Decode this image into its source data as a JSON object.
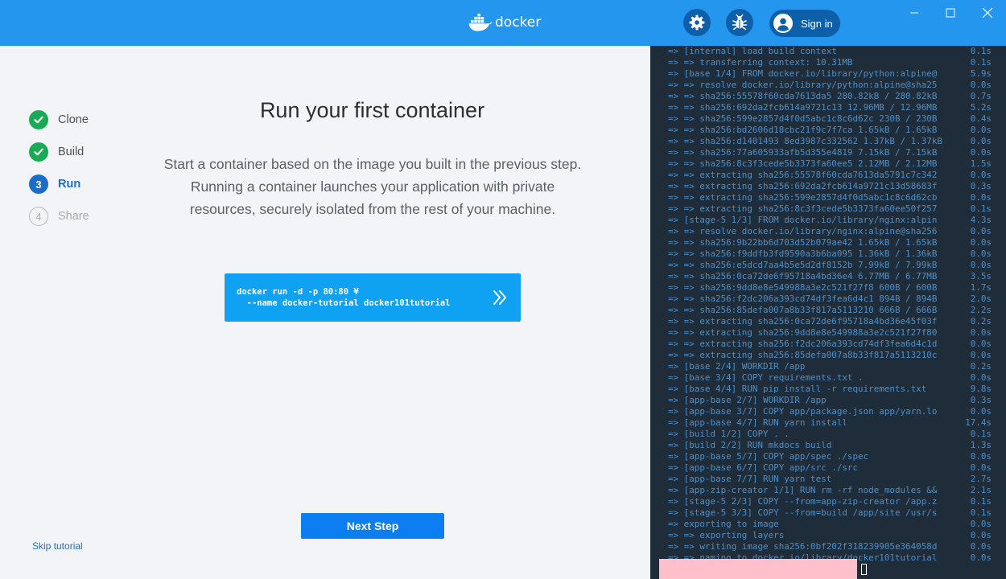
{
  "titlebar": {
    "brand": "docker",
    "signin_label": "Sign in",
    "icons": [
      "settings-icon",
      "bug-icon",
      "user-icon",
      "minimize-icon",
      "maximize-icon",
      "close-icon"
    ]
  },
  "steps": [
    {
      "number": "1",
      "label": "Clone",
      "state": "done"
    },
    {
      "number": "2",
      "label": "Build",
      "state": "done"
    },
    {
      "number": "3",
      "label": "Run",
      "state": "active"
    },
    {
      "number": "4",
      "label": "Share",
      "state": "todo"
    }
  ],
  "skip_label": "Skip tutorial",
  "main": {
    "title": "Run your first container",
    "description": "Start a container based on the image you built in the previous step. Running a container launches your application with private resources, securely isolated from the rest of your machine.",
    "command": "docker run -d -p 80:80 ¥\n  --name docker-tutorial docker101tutorial",
    "next_label": "Next Step"
  },
  "colors": {
    "accent": "#2496ed",
    "done": "#1aaa55",
    "active": "#1d6cc9",
    "command_bg": "#0fa2f2",
    "terminal_bg": "#1f2c39",
    "terminal_text": "#4f8fc7"
  },
  "terminal": {
    "lines": [
      {
        "t": "=> [internal] load build context",
        "tm": "0.1s"
      },
      {
        "t": "=> => transferring context: 10.31MB",
        "tm": "0.1s"
      },
      {
        "t": "=> [base 1/4] FROM docker.io/library/python:alpine@",
        "tm": "5.9s"
      },
      {
        "t": "=> => resolve docker.io/library/python:alpine@sha25",
        "tm": "0.0s"
      },
      {
        "t": "=> => sha256:55578f60cda7613da5 280.82kB / 280.82kB",
        "tm": "0.7s"
      },
      {
        "t": "=> => sha256:692da2fcb614a9721c13 12.96MB / 12.96MB",
        "tm": "5.2s"
      },
      {
        "t": "=> => sha256:599e2857d4f0d5abc1c8c6d62c 230B / 230B",
        "tm": "0.4s"
      },
      {
        "t": "=> => sha256:bd2606d18cbc21f9c7f7ca 1.65kB / 1.65kB",
        "tm": "0.0s"
      },
      {
        "t": "=> => sha256:d1401493 8ed3987c332562 1.37kB / 1.37kB",
        "tm": "0.0s"
      },
      {
        "t": "=> => sha256:77a605933afb5d355e4819 7.15kB / 7.15kB",
        "tm": "0.0s"
      },
      {
        "t": "=> => sha256:8c3f3cede5b3373fa60ee5 2.12MB / 2.12MB",
        "tm": "1.5s"
      },
      {
        "t": "=> => extracting sha256:55578f60cda7613da5791c7c342",
        "tm": "0.0s"
      },
      {
        "t": "=> => extracting sha256:692da2fcb614a9721c13d58683f",
        "tm": "0.3s"
      },
      {
        "t": "=> => extracting sha256:599e2857d4f0d5abc1c8c6d62cb",
        "tm": "0.0s"
      },
      {
        "t": "=> => extracting sha256:8c3f3cede5b3373fa60ee50f257",
        "tm": "0.1s"
      },
      {
        "t": "=> [stage-5 1/3] FROM docker.io/library/nginx:alpin",
        "tm": "4.3s"
      },
      {
        "t": "=> => resolve docker.io/library/nginx:alpine@sha256",
        "tm": "0.0s"
      },
      {
        "t": "=> => sha256:9b22bb6d703d52b079ae42 1.65kB / 1.65kB",
        "tm": "0.0s"
      },
      {
        "t": "=> => sha256:f9ddfb3fd9590a3b6ba095 1.36kB / 1.36kB",
        "tm": "0.0s"
      },
      {
        "t": "=> => sha256:e5dcd7aa4b5e5d2df8152b 7.99kB / 7.99kB",
        "tm": "0.0s"
      },
      {
        "t": "=> => sha256:0ca72de6f95718a4bd36e4 6.77MB / 6.77MB",
        "tm": "3.5s"
      },
      {
        "t": "=> => sha256:9dd8e8e549988a3e2c521f27f8 600B / 600B",
        "tm": "1.7s"
      },
      {
        "t": "=> => sha256:f2dc206a393cd74df3fea6d4c1 894B / 894B",
        "tm": "2.0s"
      },
      {
        "t": "=> => sha256:85defa007a8b33f817a5113210 666B / 666B",
        "tm": "2.2s"
      },
      {
        "t": "=> => extracting sha256:0ca72de6f95718a4bd36e45f03f",
        "tm": "0.2s"
      },
      {
        "t": "=> => extracting sha256:9dd8e8e549988a3e2c521f27f80",
        "tm": "0.0s"
      },
      {
        "t": "=> => extracting sha256:f2dc206a393cd74df3fea6d4c1d",
        "tm": "0.0s"
      },
      {
        "t": "=> => extracting sha256:85defa007a8b33f817a5113210c",
        "tm": "0.0s"
      },
      {
        "t": "=> [base 2/4] WORKDIR /app",
        "tm": "0.2s"
      },
      {
        "t": "=> [base 3/4] COPY requirements.txt .",
        "tm": "0.0s"
      },
      {
        "t": "=> [base 4/4] RUN pip install -r requirements.txt",
        "tm": "9.8s"
      },
      {
        "t": "=> [app-base 2/7] WORKDIR /app",
        "tm": "0.3s"
      },
      {
        "t": "=> [app-base 3/7] COPY app/package.json app/yarn.lo",
        "tm": "0.0s"
      },
      {
        "t": "=> [app-base 4/7] RUN yarn install",
        "tm": "17.4s"
      },
      {
        "t": "=> [build 1/2] COPY . .",
        "tm": "0.1s"
      },
      {
        "t": "=> [build 2/2] RUN mkdocs build",
        "tm": "1.3s"
      },
      {
        "t": "=> [app-base 5/7] COPY app/spec ./spec",
        "tm": "0.0s"
      },
      {
        "t": "=> [app-base 6/7] COPY app/src ./src",
        "tm": "0.0s"
      },
      {
        "t": "=> [app-base 7/7] RUN yarn test",
        "tm": "2.7s"
      },
      {
        "t": "=> [app-zip-creator 1/1] RUN rm -rf node_modules &&",
        "tm": "2.1s"
      },
      {
        "t": "=> [stage-5 2/3] COPY --from=app-zip-creator /app.z",
        "tm": "0.1s"
      },
      {
        "t": "=> [stage-5 3/3] COPY --from=build /app/site /usr/s",
        "tm": "0.1s"
      },
      {
        "t": "=> exporting to image",
        "tm": "0.0s"
      },
      {
        "t": "=> => exporting layers",
        "tm": "0.0s"
      },
      {
        "t": "=> => writing image sha256:0bf202f318239905e364058d",
        "tm": "0.0s"
      },
      {
        "t": "=> => naming to docker.io/library/docker101tutorial",
        "tm": "0.0s"
      }
    ]
  }
}
